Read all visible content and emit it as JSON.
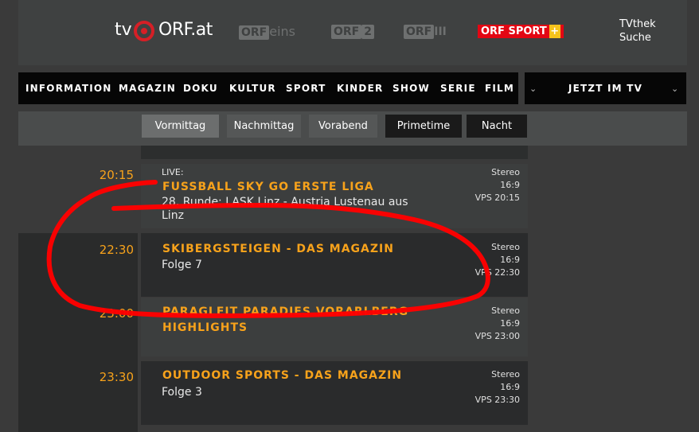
{
  "header": {
    "logo_tv": "tv",
    "logo_orf": "ORF.at",
    "channels": {
      "orf_eins": {
        "box": "ORF",
        "rest": "eins"
      },
      "orf2": {
        "box": "ORF",
        "rest": "2"
      },
      "orf3": {
        "box": "ORF",
        "rest": "III"
      },
      "orf_sport": {
        "prefix": "ORF",
        "name": "SPORT",
        "plus": "+"
      }
    },
    "tvthek": "TVthek",
    "suche": "Suche"
  },
  "nav": {
    "items": [
      "INFORMATION",
      "MAGAZIN",
      "DOKU",
      "KULTUR",
      "SPORT",
      "KINDER",
      "SHOW",
      "SERIE",
      "FILM"
    ],
    "jetzt": "JETZT IM TV"
  },
  "tabs": [
    "Vormittag",
    "Nachmittag",
    "Vorabend",
    "Primetime",
    "Nacht"
  ],
  "programs": [
    {
      "time": "20:15",
      "live": "LIVE:",
      "title": "FUSSBALL SKY GO ERSTE LIGA",
      "sub1": "28. Runde: LASK Linz - Austria Lustenau aus",
      "sub2": "Linz",
      "audio": "Stereo",
      "format": "16:9",
      "vps": "VPS 20:15"
    },
    {
      "time": "22:30",
      "title": "SKIBERGSTEIGEN - DAS MAGAZIN",
      "sub1": "Folge 7",
      "audio": "Stereo",
      "format": "16:9",
      "vps": "VPS 22:30"
    },
    {
      "time": "23:00",
      "title": "PARAGLEIT PARADIES VORARLBERG",
      "title2": "HIGHLIGHTS",
      "audio": "Stereo",
      "format": "16:9",
      "vps": "VPS 23:00"
    },
    {
      "time": "23:30",
      "title": "OUTDOOR SPORTS - DAS MAGAZIN",
      "sub1": "Folge 3",
      "audio": "Stereo",
      "format": "16:9",
      "vps": "VPS 23:30"
    }
  ],
  "colors": {
    "accent": "#f7a21b",
    "annotation": "#ff0000",
    "orf_red": "#e30613"
  }
}
